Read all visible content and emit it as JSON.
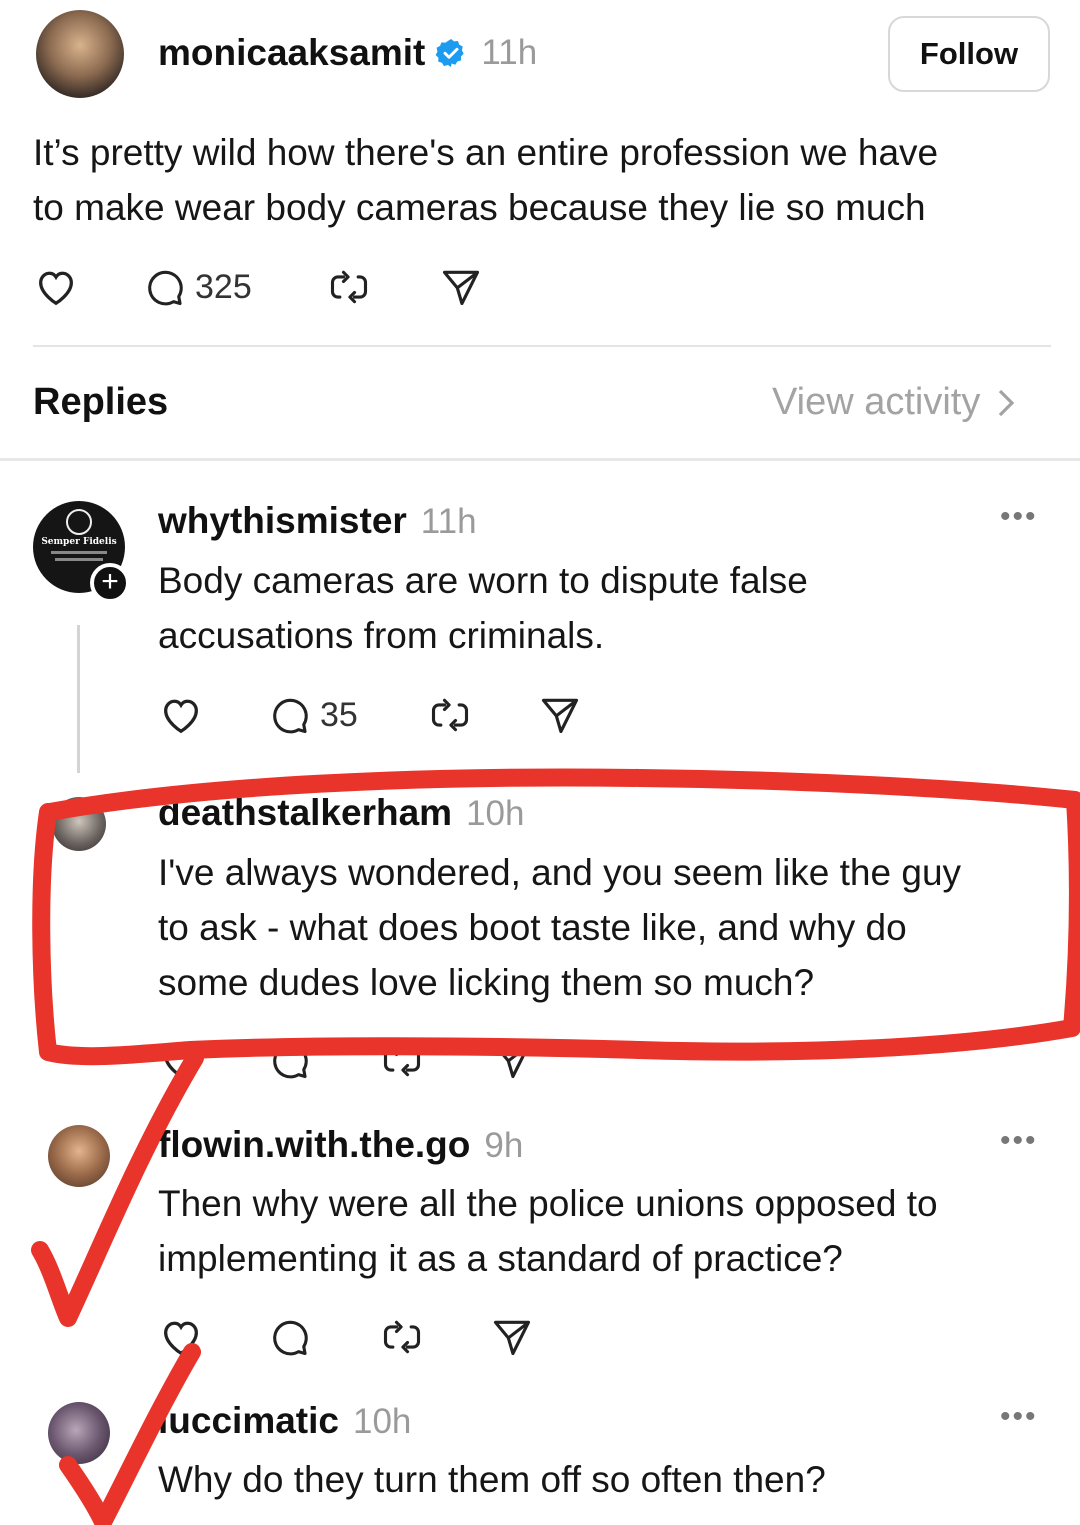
{
  "post": {
    "username": "monicaaksamit",
    "time": "11h",
    "follow_label": "Follow",
    "text_line1": "It’s pretty wild how there's an entire profession we have",
    "text_line2": "to make wear body cameras because they lie so much",
    "reply_count": "325"
  },
  "replies_header": {
    "title": "Replies",
    "view_activity": "View activity"
  },
  "replies": [
    {
      "username": "whythismister",
      "time": "11h",
      "avatar_text": "Semper Fidelis",
      "text_line1": "Body cameras are worn to dispute false",
      "text_line2": "accusations from criminals.",
      "reply_count": "35"
    },
    {
      "username": "deathstalkerham",
      "time": "10h",
      "text_line1": "I've always wondered, and you seem like the guy",
      "text_line2": "to ask - what does boot taste like, and why do",
      "text_line3": "some dudes love licking them so much?"
    },
    {
      "username": "flowin.with.the.go",
      "time": "9h",
      "text_line1": "Then why were all the police unions opposed to",
      "text_line2": "implementing it as a standard of practice?"
    },
    {
      "username": "luccimatic",
      "time": "10h",
      "text_line1": "Why do they turn them off so often then?"
    }
  ],
  "icons": {
    "like": "heart-icon",
    "reply": "comment-icon",
    "repost": "repost-icon",
    "share": "send-icon",
    "verified": "verified-badge-icon",
    "more": "more-icon"
  },
  "colors": {
    "annotation_red": "#e8342b",
    "verified_blue": "#1d9bf0",
    "muted_text": "#9a9a9a"
  }
}
